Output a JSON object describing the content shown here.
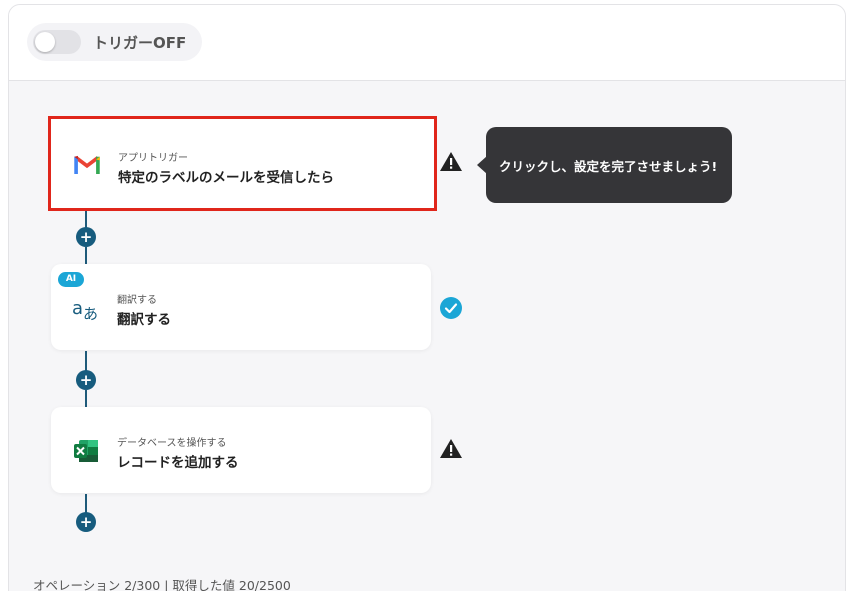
{
  "header": {
    "trigger_toggle_label": "トリガーOFF"
  },
  "flow": {
    "steps": [
      {
        "subtitle": "アプリトリガー",
        "title": "特定のラベルのメールを受信したら",
        "icon": "gmail-icon",
        "status": "warning"
      },
      {
        "subtitle": "翻訳する",
        "title": "翻訳する",
        "icon": "translate-icon",
        "badge": "AI",
        "status": "done"
      },
      {
        "subtitle": "データベースを操作する",
        "title": "レコードを追加する",
        "icon": "excel-icon",
        "status": "warning"
      }
    ]
  },
  "tooltip": {
    "text": "クリックし、設定を完了させましょう!"
  },
  "footer": {
    "usage": "オペレーション 2/300 | 取得した値 20/2500"
  },
  "colors": {
    "accent": "#175c7e",
    "selected_outline": "#e0261b",
    "done": "#1ba6d6"
  }
}
